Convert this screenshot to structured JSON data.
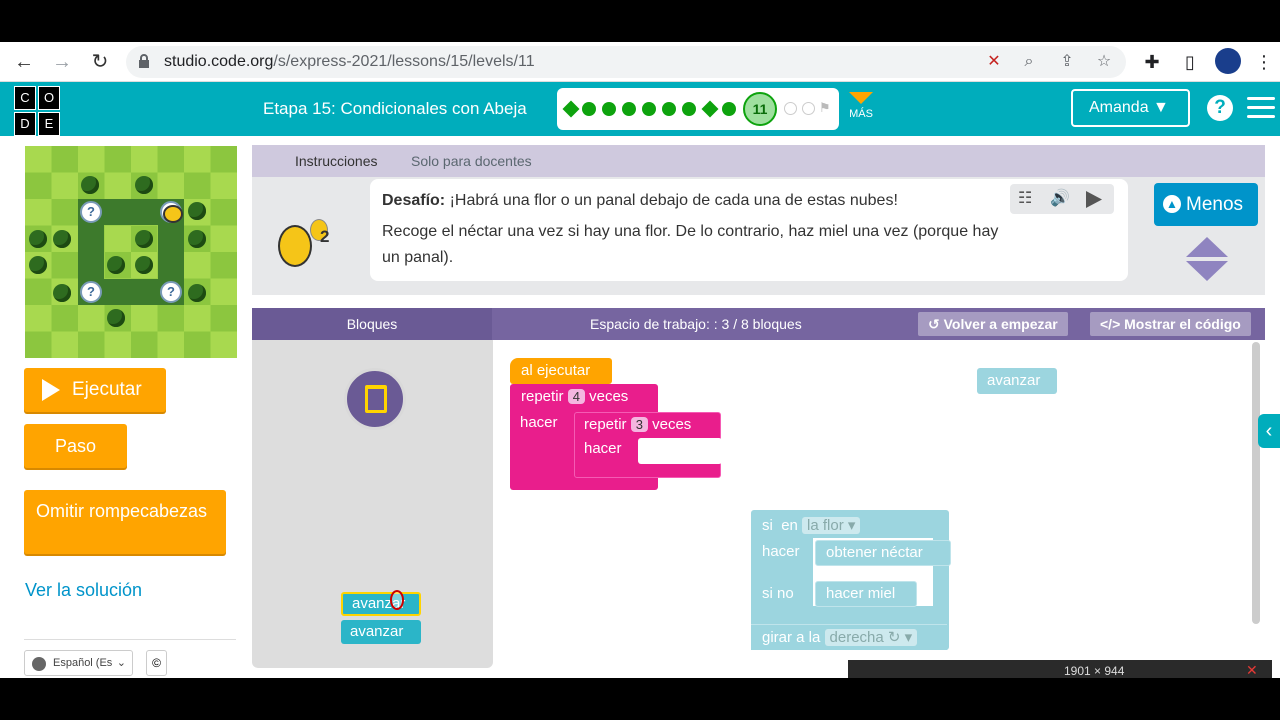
{
  "browser": {
    "url_host": "studio.code.org",
    "url_path": "/s/express-2021/lessons/15/levels/11"
  },
  "header": {
    "logo_letters": [
      "C",
      "O",
      "D",
      "E"
    ],
    "stage_title": "Etapa 15: Condicionales con Abeja",
    "current_level": "11",
    "more_label": "MÁS",
    "user_name": "Amanda",
    "help_label": "?"
  },
  "maze": {
    "clouds": [
      "?",
      "?",
      "?",
      "?"
    ]
  },
  "controls": {
    "run_label": "Ejecutar",
    "step_label": "Paso",
    "skip_label": "Omitir rompecabezas",
    "solution_label": "Ver la solución",
    "language_label": "Español (Es",
    "copyright_label": "©"
  },
  "instructions": {
    "tabs": [
      "Instrucciones",
      "Solo para docentes"
    ],
    "bee_count": "2",
    "challenge_label": "Desafío:",
    "challenge_text": " ¡Habrá una flor o un panal debajo de cada una de estas nubes!",
    "body_text": "Recoge el néctar una vez si hay una flor. De lo contrario, haz miel una vez (porque hay un panal).",
    "less_button": "Menos"
  },
  "workspace": {
    "blocks_header": "Bloques",
    "workspace_count": "Espacio de trabajo: : 3 / 8 bloques",
    "restart_button": "Volver a empezar",
    "show_code_button": "Mostrar el código"
  },
  "toolbox": {
    "blocks": [
      "avanzar",
      "avanzar"
    ]
  },
  "program": {
    "when_run": "al ejecutar",
    "repeat_label": "repetir",
    "times_label": "veces",
    "do_label": "hacer",
    "outer_count": "4",
    "inner_count": "3",
    "floating_move": "avanzar",
    "if_label": "si",
    "on_label": "en",
    "condition": "la flor ▾",
    "get_nectar": "obtener néctar",
    "else_label": "si no",
    "make_honey": "hacer miel",
    "turn_label": "girar a la",
    "direction": "derecha ↻ ▾"
  },
  "taskbar": {
    "resolution": "1901 × 944"
  },
  "colors": {
    "header": "#00adbc",
    "accent_orange": "#ffa400",
    "loop_pink": "#e91e8c",
    "action_teal": "#2bb5c8",
    "workspace_purple": "#7665a0"
  }
}
